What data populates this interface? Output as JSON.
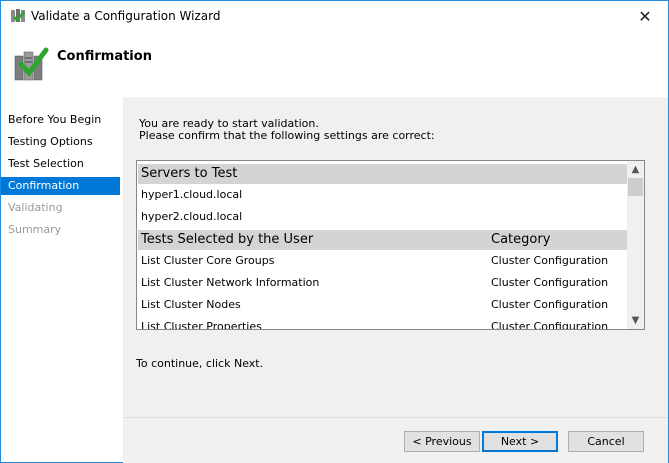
{
  "window": {
    "title": "Validate a Configuration Wizard",
    "close_glyph": "✕"
  },
  "header": {
    "heading": "Confirmation"
  },
  "sidebar": {
    "items": [
      {
        "label": "Before You Begin",
        "state": "normal"
      },
      {
        "label": "Testing Options",
        "state": "normal"
      },
      {
        "label": "Test Selection",
        "state": "normal"
      },
      {
        "label": "Confirmation",
        "state": "active"
      },
      {
        "label": "Validating",
        "state": "disabled"
      },
      {
        "label": "Summary",
        "state": "disabled"
      }
    ]
  },
  "main": {
    "intro_line1": "You are ready to start validation.",
    "intro_line2": "Please confirm that the following settings are correct:",
    "servers_header": "Servers to Test",
    "servers": [
      "hyper1.cloud.local",
      "hyper2.cloud.local"
    ],
    "tests_header": "Tests Selected by the User",
    "category_header": "Category",
    "tests": [
      {
        "name": "List Cluster Core Groups",
        "category": "Cluster Configuration"
      },
      {
        "name": "List Cluster Network Information",
        "category": "Cluster Configuration"
      },
      {
        "name": "List Cluster Nodes",
        "category": "Cluster Configuration"
      },
      {
        "name": "List Cluster Properties",
        "category": "Cluster Configuration"
      }
    ],
    "continue_text": "To continue, click Next."
  },
  "buttons": {
    "previous": "< Previous",
    "next": "Next >",
    "cancel": "Cancel"
  },
  "colors": {
    "accent": "#0078d7",
    "disabled_text": "#9a9a9a",
    "panel_bg": "#f0f0f0"
  },
  "icons": {
    "app": "cluster-wizard-icon",
    "header": "server-checkmark-icon"
  }
}
